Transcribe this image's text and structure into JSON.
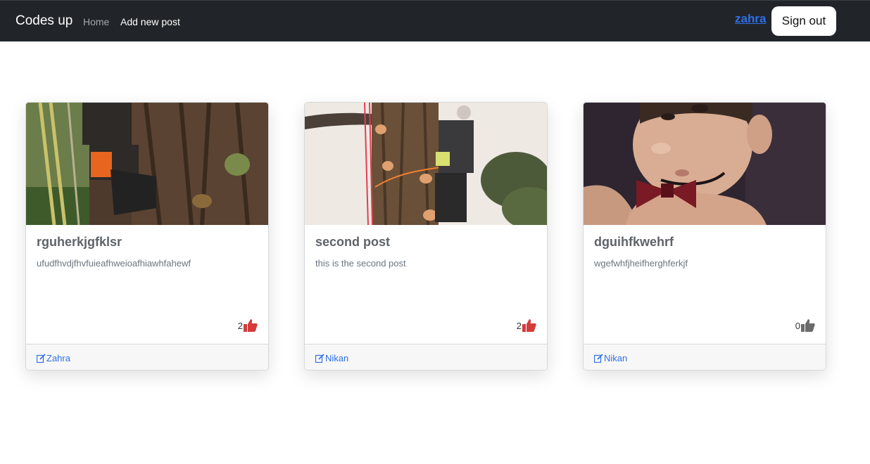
{
  "navbar": {
    "brand": "Codes up",
    "links": [
      {
        "label": "Home"
      },
      {
        "label": "Add new post"
      }
    ],
    "user": "zahra",
    "signout_label": "Sign out"
  },
  "posts": [
    {
      "title": "rguherkjgfklsr",
      "body": "ufudfhvdjfhvfuieafhweioafhiawhfahewf",
      "likes": "2",
      "liked": true,
      "author": "Zahra"
    },
    {
      "title": "second post",
      "body": "this is the second post",
      "likes": "2",
      "liked": true,
      "author": "Nikan"
    },
    {
      "title": "dguihfkwehrf",
      "body": "wgefwhfjheifherghferkjf",
      "likes": "0",
      "liked": false,
      "author": "Nikan"
    }
  ],
  "colors": {
    "navbar_bg": "#212529",
    "link": "#2f6fe9",
    "like_active": "#d43b3b",
    "like_inactive": "#6b6b6b"
  },
  "icons": {
    "like": "thumbs-up-icon",
    "author": "edit-icon"
  }
}
